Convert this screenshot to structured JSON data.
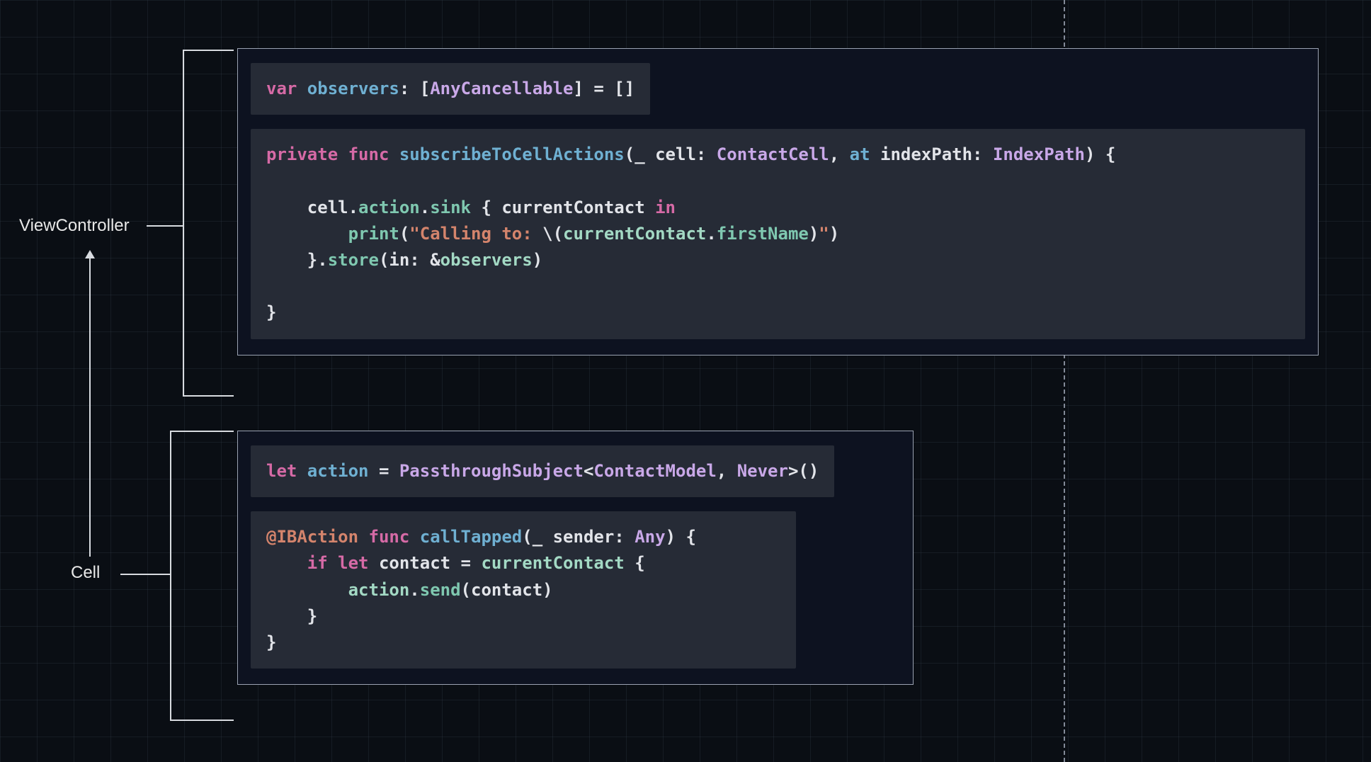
{
  "labels": {
    "viewController": "ViewController",
    "cell": "Cell"
  },
  "viewController": {
    "block1": {
      "tokens": [
        {
          "t": "var ",
          "c": "kw-decl"
        },
        {
          "t": "observers",
          "c": "ident-def"
        },
        {
          "t": ": [",
          "c": "plain"
        },
        {
          "t": "AnyCancellable",
          "c": "type"
        },
        {
          "t": "] = []",
          "c": "plain"
        }
      ]
    },
    "block2": {
      "lines": [
        [
          {
            "t": "private ",
            "c": "kw-decl"
          },
          {
            "t": "func ",
            "c": "kw-decl"
          },
          {
            "t": "subscribeToCellActions",
            "c": "ident-def"
          },
          {
            "t": "(",
            "c": "plain"
          },
          {
            "t": "_",
            "c": "plain"
          },
          {
            "t": " cell: ",
            "c": "plain"
          },
          {
            "t": "ContactCell",
            "c": "type"
          },
          {
            "t": ", ",
            "c": "plain"
          },
          {
            "t": "at",
            "c": "ident-def"
          },
          {
            "t": " indexPath: ",
            "c": "plain"
          },
          {
            "t": "IndexPath",
            "c": "type"
          },
          {
            "t": ") {",
            "c": "plain"
          }
        ],
        [],
        [
          {
            "t": "    cell.",
            "c": "plain"
          },
          {
            "t": "action",
            "c": "prop"
          },
          {
            "t": ".",
            "c": "plain"
          },
          {
            "t": "sink",
            "c": "method"
          },
          {
            "t": " { currentContact ",
            "c": "plain"
          },
          {
            "t": "in",
            "c": "kw-in"
          }
        ],
        [
          {
            "t": "        ",
            "c": "plain"
          },
          {
            "t": "print",
            "c": "method"
          },
          {
            "t": "(",
            "c": "plain"
          },
          {
            "t": "\"Calling to: ",
            "c": "str"
          },
          {
            "t": "\\(",
            "c": "plain"
          },
          {
            "t": "currentContact",
            "c": "ident-use"
          },
          {
            "t": ".",
            "c": "plain"
          },
          {
            "t": "firstName",
            "c": "prop"
          },
          {
            "t": ")",
            "c": "plain"
          },
          {
            "t": "\"",
            "c": "str"
          },
          {
            "t": ")",
            "c": "plain"
          }
        ],
        [
          {
            "t": "    }.",
            "c": "plain"
          },
          {
            "t": "store",
            "c": "method"
          },
          {
            "t": "(in: &",
            "c": "plain"
          },
          {
            "t": "observers",
            "c": "ident-use"
          },
          {
            "t": ")",
            "c": "plain"
          }
        ],
        [],
        [
          {
            "t": "}",
            "c": "plain"
          }
        ]
      ]
    }
  },
  "cell": {
    "block1": {
      "tokens": [
        {
          "t": "let ",
          "c": "kw-decl"
        },
        {
          "t": "action",
          "c": "ident-def"
        },
        {
          "t": " = ",
          "c": "plain"
        },
        {
          "t": "PassthroughSubject",
          "c": "type"
        },
        {
          "t": "<",
          "c": "plain"
        },
        {
          "t": "ContactModel",
          "c": "type"
        },
        {
          "t": ", ",
          "c": "plain"
        },
        {
          "t": "Never",
          "c": "type"
        },
        {
          "t": ">()",
          "c": "plain"
        }
      ]
    },
    "block2": {
      "lines": [
        [
          {
            "t": "@IBAction",
            "c": "attr"
          },
          {
            "t": " ",
            "c": "plain"
          },
          {
            "t": "func ",
            "c": "kw-decl"
          },
          {
            "t": "callTapped",
            "c": "ident-def"
          },
          {
            "t": "(",
            "c": "plain"
          },
          {
            "t": "_",
            "c": "plain"
          },
          {
            "t": " sender: ",
            "c": "plain"
          },
          {
            "t": "Any",
            "c": "type"
          },
          {
            "t": ") {",
            "c": "plain"
          }
        ],
        [
          {
            "t": "    ",
            "c": "plain"
          },
          {
            "t": "if ",
            "c": "kw-decl"
          },
          {
            "t": "let ",
            "c": "kw-decl"
          },
          {
            "t": "contact = ",
            "c": "plain"
          },
          {
            "t": "currentContact",
            "c": "ident-use"
          },
          {
            "t": " {",
            "c": "plain"
          }
        ],
        [
          {
            "t": "        ",
            "c": "plain"
          },
          {
            "t": "action",
            "c": "ident-use"
          },
          {
            "t": ".",
            "c": "plain"
          },
          {
            "t": "send",
            "c": "method"
          },
          {
            "t": "(contact)",
            "c": "plain"
          }
        ],
        [
          {
            "t": "    }",
            "c": "plain"
          }
        ],
        [
          {
            "t": "}",
            "c": "plain"
          }
        ]
      ]
    }
  }
}
